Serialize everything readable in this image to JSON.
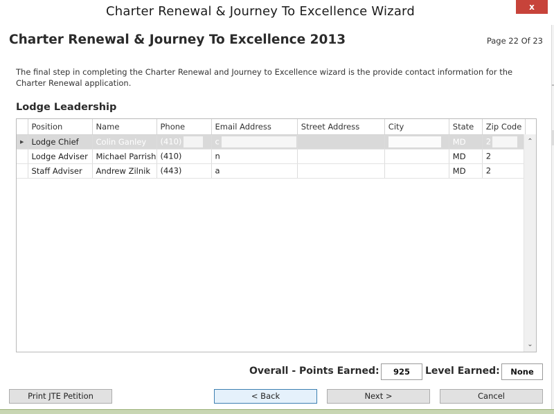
{
  "window": {
    "title": "Charter Renewal & Journey To Excellence Wizard",
    "close_glyph": "x"
  },
  "page": {
    "heading": "Charter Renewal & Journey To Excellence 2013",
    "counter": "Page 22 Of 23",
    "description": "The final step in completing the Charter Renewal and Journey to Excellence wizard is the provide contact information for the Charter Renewal application."
  },
  "section": {
    "title": "Lodge Leadership"
  },
  "grid": {
    "columns": [
      "Position",
      "Name",
      "Phone",
      "Email Address",
      "Street Address",
      "City",
      "State",
      "Zip Code"
    ],
    "rows": [
      {
        "position": "Lodge Chief",
        "name": "Colin Ganley",
        "phone": "(410)",
        "email": "c",
        "street": "",
        "city": "",
        "state": "MD",
        "zip": "2",
        "selected": true
      },
      {
        "position": "Lodge Adviser",
        "name": "Michael Parrish",
        "phone": "(410)",
        "email": "n",
        "street": "",
        "city": "",
        "state": "MD",
        "zip": "2",
        "selected": false
      },
      {
        "position": "Staff Adviser",
        "name": "Andrew Zilnik",
        "phone": "(443)",
        "email": "a",
        "street": "",
        "city": "",
        "state": "MD",
        "zip": "2",
        "selected": false
      }
    ],
    "row_indicator_glyph": "▶",
    "scroll_up_glyph": "⌃",
    "scroll_down_glyph": "⌄"
  },
  "summary": {
    "points_label": "Overall - Points Earned:",
    "points_value": "925",
    "level_label": "Level Earned:",
    "level_value": "None"
  },
  "buttons": {
    "print": "Print JTE Petition",
    "back": "< Back",
    "next": "Next >",
    "cancel": "Cancel"
  },
  "colors": {
    "close": "#c7433a",
    "selected_row": "#d9d9d9",
    "focus_border": "#3c7fb1"
  }
}
